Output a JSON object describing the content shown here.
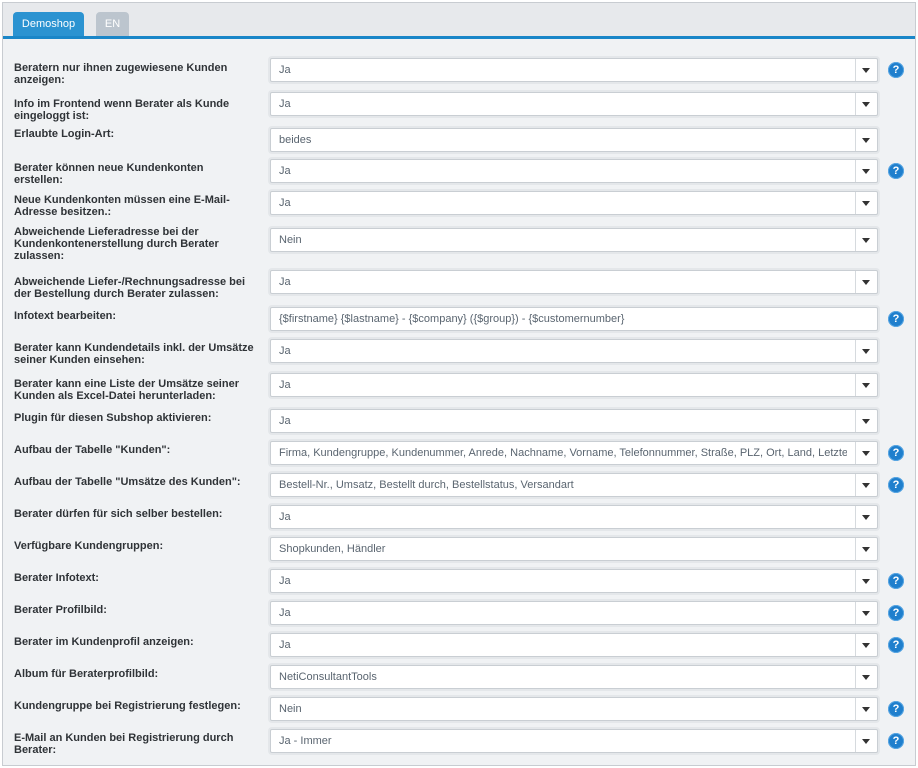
{
  "tabs": [
    {
      "label": "Demoshop",
      "active": true
    },
    {
      "label": "EN",
      "active": false
    }
  ],
  "colors": {
    "accent": "#2b93d1",
    "help": "#1f7fcd",
    "tab_inactive": "#bcc5ce"
  },
  "help_icon_glyph": "?",
  "settings": [
    {
      "label": "Beratern nur ihnen zugewiesene Kunden anzeigen:",
      "value": "Ja",
      "type": "select",
      "help": true
    },
    {
      "label": "Info im Frontend wenn Berater als Kunde eingeloggt ist:",
      "value": "Ja",
      "type": "select",
      "help": false
    },
    {
      "label": "Erlaubte Login-Art:",
      "value": "beides",
      "type": "select",
      "help": false
    },
    {
      "label": "Berater können neue Kundenkonten erstellen:",
      "value": "Ja",
      "type": "select",
      "help": true
    },
    {
      "label": "Neue Kundenkonten müssen eine E-Mail-Adresse besitzen.:",
      "value": "Ja",
      "type": "select",
      "help": false
    },
    {
      "label": "Abweichende Lieferadresse bei der Kundenkontenerstellung durch Berater zulassen:",
      "value": "Nein",
      "type": "select",
      "help": false
    },
    {
      "label": "Abweichende Liefer-/Rechnungsadresse bei der Bestellung durch Berater zulassen:",
      "value": "Ja",
      "type": "select",
      "help": false
    },
    {
      "label": "Infotext bearbeiten:",
      "value": "{$firstname} {$lastname} - {$company} ({$group}) - {$customernumber}",
      "type": "text",
      "help": true
    },
    {
      "label": "Berater kann Kundendetails inkl. der Umsätze seiner Kunden einsehen:",
      "value": "Ja",
      "type": "select",
      "help": false
    },
    {
      "label": "Berater kann eine Liste der Umsätze seiner Kunden als Excel-Datei herunterladen:",
      "value": "Ja",
      "type": "select",
      "help": false
    },
    {
      "label": "Plugin für diesen Subshop aktivieren:",
      "value": "Ja",
      "type": "select",
      "help": false
    },
    {
      "label": "Aufbau der Tabelle \"Kunden\":",
      "value": "Firma, Kundengruppe, Kundenummer, Anrede, Nachname, Vorname, Telefonnummer, Straße, PLZ, Ort, Land, Letzte",
      "type": "select",
      "help": true
    },
    {
      "label": "Aufbau der Tabelle \"Umsätze des Kunden\":",
      "value": "Bestell-Nr., Umsatz, Bestellt durch, Bestellstatus, Versandart",
      "type": "select",
      "help": true
    },
    {
      "label": "Berater dürfen für sich selber bestellen:",
      "value": "Ja",
      "type": "select",
      "help": false
    },
    {
      "label": "Verfügbare Kundengruppen:",
      "value": "Shopkunden, Händler",
      "type": "select",
      "help": false
    },
    {
      "label": "Berater Infotext:",
      "value": "Ja",
      "type": "select",
      "help": true
    },
    {
      "label": "Berater Profilbild:",
      "value": "Ja",
      "type": "select",
      "help": true
    },
    {
      "label": "Berater im Kundenprofil anzeigen:",
      "value": "Ja",
      "type": "select",
      "help": true
    },
    {
      "label": "Album für Beraterprofilbild:",
      "value": "NetiConsultantTools",
      "type": "select",
      "help": false
    },
    {
      "label": "Kundengruppe bei Registrierung festlegen:",
      "value": "Nein",
      "type": "select",
      "help": true
    },
    {
      "label": "E-Mail an Kunden bei Registrierung durch Berater:",
      "value": "Ja - Immer",
      "type": "select",
      "help": true
    }
  ]
}
